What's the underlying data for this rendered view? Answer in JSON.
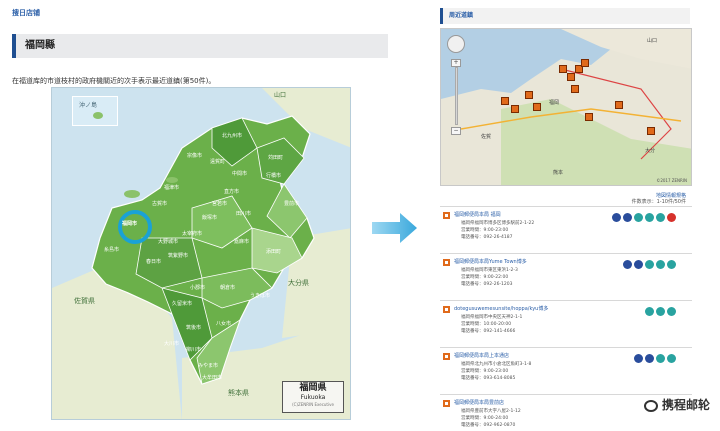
{
  "left": {
    "breadcrumb": "搜日店铺",
    "title": "福岡縣",
    "description": "在福道库的市道枝村的政府機關近的次手表示最近道鎮(第50件)。",
    "map": {
      "okinoshima": "沖ノ島",
      "yamaguchi": "山口",
      "saga": "佐賀県",
      "oita": "大分県",
      "kumamoto": "熊本県",
      "legend_ja": "福岡県",
      "legend_en": "Fukuoka",
      "legend_credit": "(C)ZENRIN Executive",
      "highlight": "福岡市",
      "city_labels": [
        "北九州市",
        "宗像市",
        "遠賀町",
        "中間市",
        "直方市",
        "飯塚市",
        "田川市",
        "行橋市",
        "豊前市",
        "苅田町",
        "福津市",
        "古賀市",
        "糸島市",
        "筑紫野市",
        "大野城市",
        "春日市",
        "太宰府市",
        "朝倉市",
        "久留米市",
        "八女市",
        "筑後市",
        "大川市",
        "柳川市",
        "みやま市",
        "大牟田市",
        "うきは市",
        "小郡市",
        "添田町",
        "宮若市",
        "嘉麻市"
      ]
    }
  },
  "right": {
    "title": "周近道鎮",
    "map": {
      "cities": [
        "山口",
        "福岡",
        "佐賀",
        "大分",
        "熊本"
      ],
      "copyright": "©2017 ZENRIN"
    },
    "link": "地図情報規格",
    "count": "件数表示：1-10件/50件",
    "stores": [
      {
        "name": "福岡郵便局本局 福岡",
        "l1": "福岡県福岡市博多区博多駅前2-1-22",
        "l2": "営業時間：9:00-23:00",
        "l3": "電話番号：092-26-4187"
      },
      {
        "name": "福岡郵便局本局Yume Town博多",
        "l1": "福岡県福岡市東区東浜1-2-3",
        "l2": "営業時間：9:00-22:00",
        "l3": "電話番号：092-26-1203"
      },
      {
        "name": "dotegusuwemesunsite/hoppa/kyu博多",
        "l1": "福岡県福岡市中央区天神2-1-1",
        "l2": "営業時間：10:00-20:00",
        "l3": "電話番号：092-141-4666"
      },
      {
        "name": "福岡郵便局本局上本通店",
        "l1": "福岡県北九州市小倉北区魚町3-1-8",
        "l2": "営業時間：9:00-23:00",
        "l3": "電話番号：093-614-8085"
      },
      {
        "name": "福岡郵便局本局豊前店",
        "l1": "福岡県豊前市大字八屋2-1-12",
        "l2": "営業時間：9:00-24:00",
        "l3": "電話番号：092-962-0870"
      }
    ]
  },
  "watermark": "携程邮轮",
  "colors": {
    "accent": "#1f4f91",
    "link": "#2b5fa8",
    "map_green": "#6bb04a",
    "poi": "#e06a1b",
    "arrow": "#49b6e4"
  }
}
